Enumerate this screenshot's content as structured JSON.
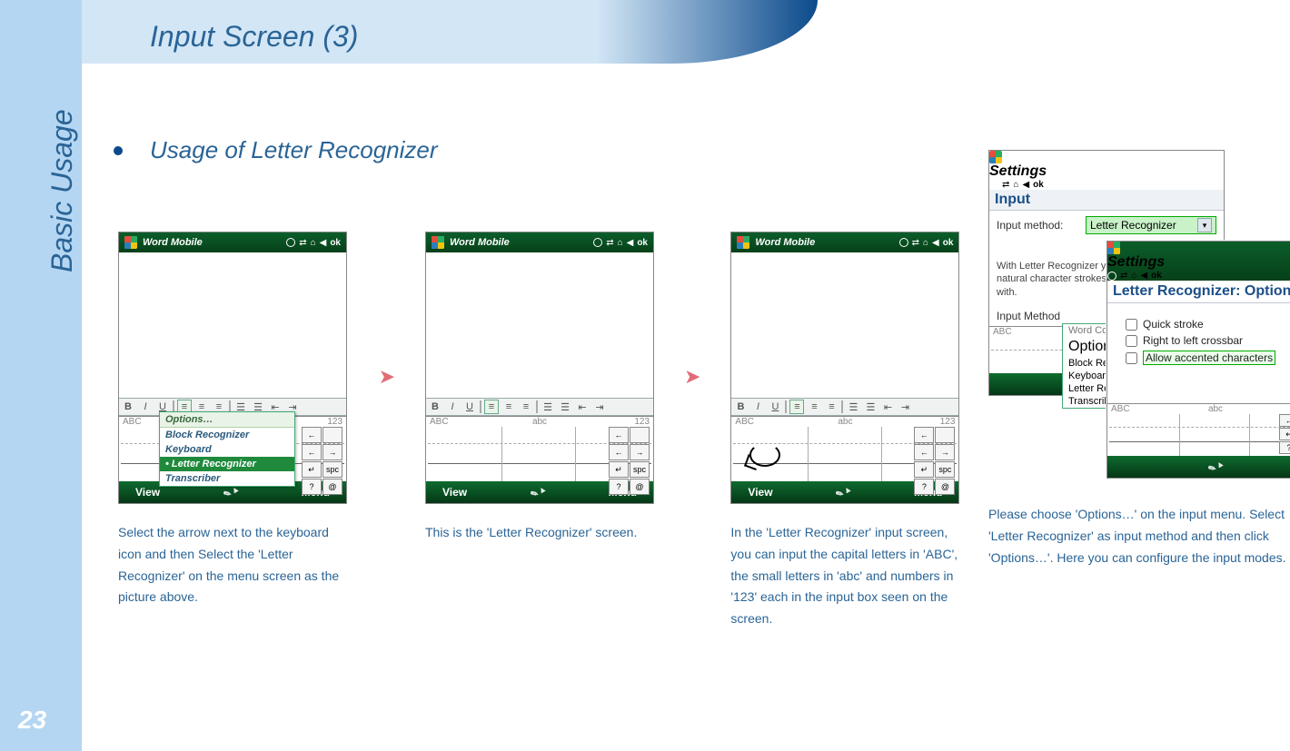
{
  "sidebar": {
    "label": "Basic Usage",
    "page_number": "23"
  },
  "page": {
    "title": "Input Screen (3)",
    "bullet": "Usage of Letter Recognizer"
  },
  "device": {
    "word_title": "Word Mobile",
    "settings_title": "Settings",
    "ok": "ok",
    "view": "View",
    "menu": "Menu",
    "fmt_b": "B",
    "fmt_i": "I",
    "fmt_u": "U",
    "zone_abc_u": "ABC",
    "zone_abc_l": "abc",
    "zone_123": "123",
    "key_bksp": "←",
    "key_left": "←",
    "key_right": "→",
    "key_enter": "↵",
    "key_spc": "spc",
    "key_q": "?",
    "key_at": "@"
  },
  "popup": {
    "options": "Options…",
    "items": [
      "Block Recognizer",
      "Keyboard",
      "Letter Recognizer",
      "Transcriber"
    ],
    "selected": "Letter Recognizer"
  },
  "settings": {
    "tab": "Input",
    "input_method_label": "Input method:",
    "input_method_value": "Letter Recognizer",
    "options_btn": "Options…",
    "desc": "With Letter Recognizer you can write using natural character strokes you may be familiar with.",
    "method_label": "Input Method",
    "popup_items": [
      "Word Com",
      "Options…",
      "Block Reco",
      "Keyboard",
      "Letter Rec",
      "Transcribe"
    ],
    "popup_highlight": "Options…"
  },
  "options_panel": {
    "title": "Letter Recognizer: Options",
    "checks": [
      "Quick stroke",
      "Right to left crossbar",
      "Allow accented characters"
    ],
    "highlight": "Allow accented characters"
  },
  "captions": {
    "c1": "Select the arrow next to the keyboard icon and then Select the 'Letter Recognizer' on the menu screen as the picture above.",
    "c2": "This is the 'Letter Recognizer' screen.",
    "c3": "In the 'Letter Recognizer' input screen, you can input the capital letters in 'ABC', the small letters in 'abc' and numbers in '123' each in the input box seen on the screen.",
    "c4": "Please choose 'Options…' on the input menu. Select 'Letter Recognizer' as input method and then click 'Options…'. Here you can configure the input modes."
  }
}
